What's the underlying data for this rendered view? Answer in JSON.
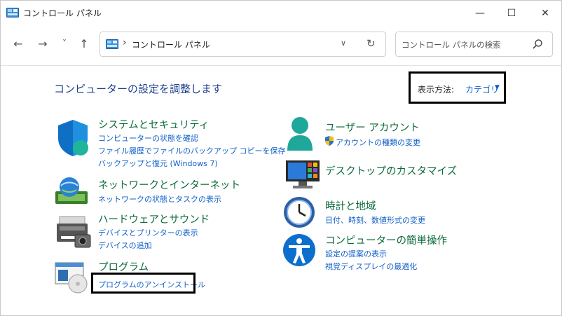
{
  "window": {
    "title": "コントロール パネル",
    "minimize_glyph": "—",
    "maximize_glyph": "☐",
    "close_glyph": "✕"
  },
  "nav": {
    "back_glyph": "←",
    "forward_glyph": "→",
    "recent_glyph": "˅",
    "up_glyph": "↑",
    "address_sep": "›",
    "address_text": "コントロール パネル",
    "address_chevron": "∨",
    "refresh_glyph": "↻",
    "search_placeholder": "コントロール パネルの検索"
  },
  "content": {
    "heading": "コンピューターの設定を調整します",
    "view_label": "表示方法:",
    "view_value": "カテゴリ",
    "view_arrow": "▼"
  },
  "categories": [
    {
      "title": "システムとセキュリティ",
      "icon": "shield-icon",
      "links": [
        "コンピューターの状態を確認",
        "ファイル履歴でファイルのバックアップ コピーを保存",
        "バックアップと復元 (Windows 7)"
      ]
    },
    {
      "title": "ネットワークとインターネット",
      "icon": "network-globe-icon",
      "links": [
        "ネットワークの状態とタスクの表示"
      ]
    },
    {
      "title": "ハードウェアとサウンド",
      "icon": "printer-icon",
      "links": [
        "デバイスとプリンターの表示",
        "デバイスの追加"
      ]
    },
    {
      "title": "プログラム",
      "icon": "programs-icon",
      "links": [
        "プログラムのアンインストール"
      ]
    },
    {
      "title": "ユーザー アカウント",
      "icon": "user-icon",
      "links": [
        "アカウントの種類の変更"
      ]
    },
    {
      "title": "デスクトップのカスタマイズ",
      "icon": "desktop-icon",
      "links": []
    },
    {
      "title": "時計と地域",
      "icon": "clock-icon",
      "links": [
        "日付、時刻、数値形式の変更"
      ]
    },
    {
      "title": "コンピューターの簡単操作",
      "icon": "accessibility-icon",
      "links": [
        "設定の提案の表示",
        "視覚ディスプレイの最適化"
      ]
    }
  ]
}
